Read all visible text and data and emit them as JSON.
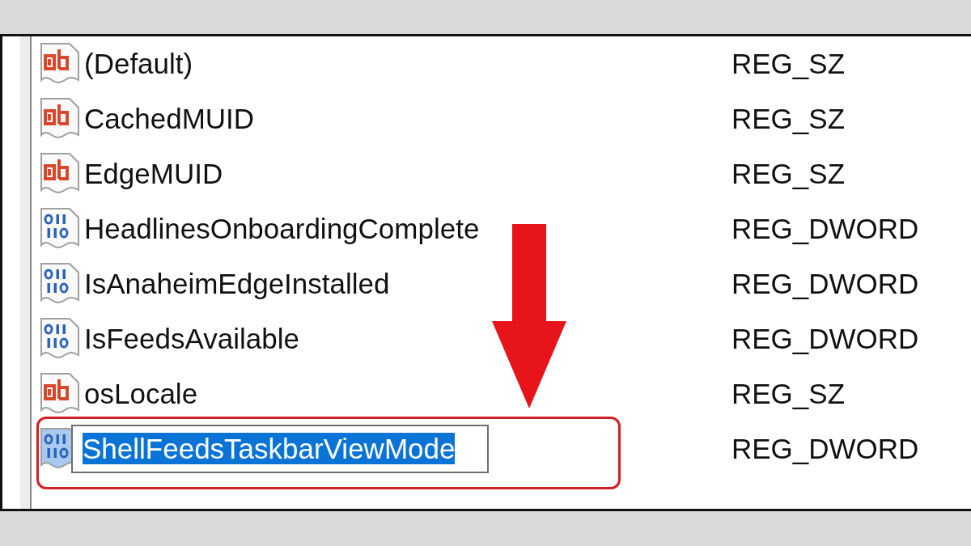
{
  "values_list": {
    "rows": [
      {
        "kind": "string",
        "name": "(Default)",
        "type": "REG_SZ",
        "editing": false
      },
      {
        "kind": "string",
        "name": "CachedMUID",
        "type": "REG_SZ",
        "editing": false
      },
      {
        "kind": "string",
        "name": "EdgeMUID",
        "type": "REG_SZ",
        "editing": false
      },
      {
        "kind": "dword",
        "name": "HeadlinesOnboardingComplete",
        "type": "REG_DWORD",
        "editing": false
      },
      {
        "kind": "dword",
        "name": "IsAnaheimEdgeInstalled",
        "type": "REG_DWORD",
        "editing": false
      },
      {
        "kind": "dword",
        "name": "IsFeedsAvailable",
        "type": "REG_DWORD",
        "editing": false
      },
      {
        "kind": "string",
        "name": "osLocale",
        "type": "REG_SZ",
        "editing": false
      },
      {
        "kind": "dword",
        "name": "ShellFeedsTaskbarViewMode",
        "type": "REG_DWORD",
        "editing": true
      }
    ]
  }
}
